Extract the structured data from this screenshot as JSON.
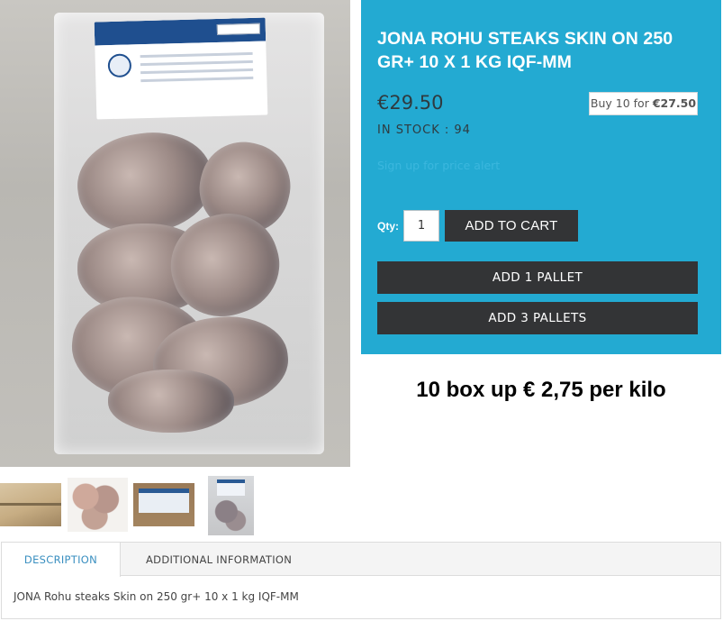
{
  "product": {
    "title": "JONA ROHU STEAKS SKIN ON 250 GR+ 10 X 1 KG IQF-MM",
    "price": "€29.50",
    "bulk_offer_prefix": "Buy 10 for ",
    "bulk_offer_price": "€27.50",
    "stock": "IN STOCK : 94",
    "price_alert_link": "Sign up for price alert"
  },
  "cart": {
    "qty_label": "Qty:",
    "qty_value": "1",
    "add_to_cart": "ADD TO CART",
    "add_1_pallet": "ADD 1 PALLET",
    "add_3_pallets": "ADD 3 PALLETS"
  },
  "promo_text": "10 box up € 2,75 per kilo",
  "thumbnails": [
    "box-thumbnail",
    "steaks-thumbnail",
    "label-thumbnail",
    "bag-thumbnail"
  ],
  "tabs": {
    "description": "DESCRIPTION",
    "additional_information": "ADDITIONAL INFORMATION",
    "description_content": "JONA Rohu steaks Skin on 250 gr+ 10 x 1 kg IQF-MM"
  },
  "colors": {
    "panel_background": "#23aad2",
    "button_background": "#333436",
    "active_tab_text": "#3a8fc0",
    "alert_link": "#3bb7de"
  }
}
